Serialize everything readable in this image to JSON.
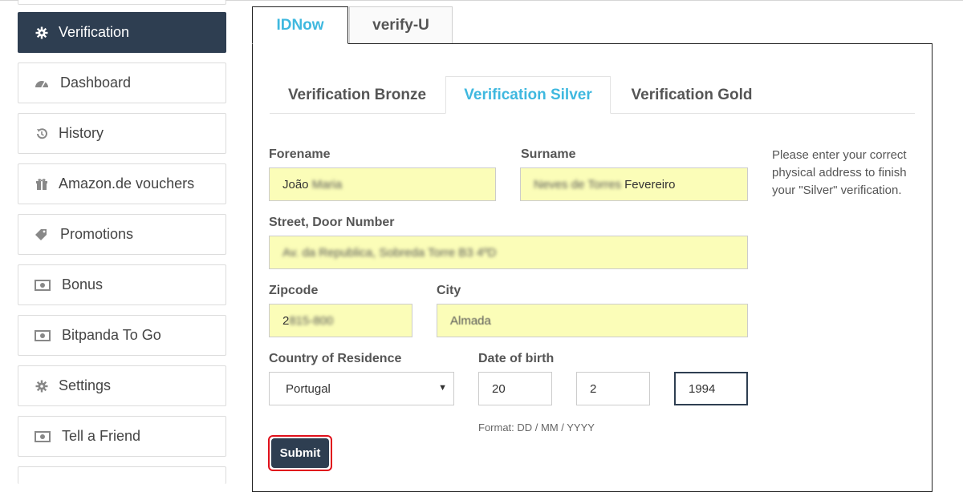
{
  "sidebar": {
    "items": [
      {
        "label": "Verification",
        "icon": "gear-icon",
        "active": true
      },
      {
        "label": "Dashboard",
        "icon": "dashboard-icon"
      },
      {
        "label": "History",
        "icon": "history-icon"
      },
      {
        "label": "Amazon.de vouchers",
        "icon": "gift-icon"
      },
      {
        "label": "Promotions",
        "icon": "tag-icon"
      },
      {
        "label": "Bonus",
        "icon": "money-icon"
      },
      {
        "label": "Bitpanda To Go",
        "icon": "money-icon"
      },
      {
        "label": "Settings",
        "icon": "gear-icon"
      },
      {
        "label": "Tell a Friend",
        "icon": "money-icon"
      }
    ]
  },
  "tabs": [
    {
      "label": "IDNow",
      "active": true
    },
    {
      "label": "verify-U",
      "active": false
    }
  ],
  "subtabs": [
    {
      "label": "Verification Bronze",
      "active": false
    },
    {
      "label": "Verification Silver",
      "active": true
    },
    {
      "label": "Verification Gold",
      "active": false
    }
  ],
  "form": {
    "forename": {
      "label": "Forename",
      "value_clear": "João",
      "value_blurred": "Maria"
    },
    "surname": {
      "label": "Surname",
      "value_blurred": "Neves de Torres",
      "value_clear": "Fevereiro"
    },
    "street": {
      "label": "Street, Door Number",
      "value_blurred": "Av. da Republica, Sobreda Torre B3 4ºD"
    },
    "zipcode": {
      "label": "Zipcode",
      "value_clear": "2",
      "value_blurred": "815-800"
    },
    "city": {
      "label": "City",
      "value": "Almada"
    },
    "country": {
      "label": "Country of Residence",
      "value": "Portugal"
    },
    "dob": {
      "label": "Date of birth",
      "day": "20",
      "month": "2",
      "year": "1994",
      "format": "Format: DD / MM / YYYY"
    },
    "submit_label": "Submit"
  },
  "help_text": "Please enter your correct physical address to finish your \"Silver\" verification.",
  "colors": {
    "accent": "#3fb8df",
    "sidebar_active": "#2e3e51",
    "autofill": "#fbfdb8",
    "highlight": "#e0101b"
  }
}
